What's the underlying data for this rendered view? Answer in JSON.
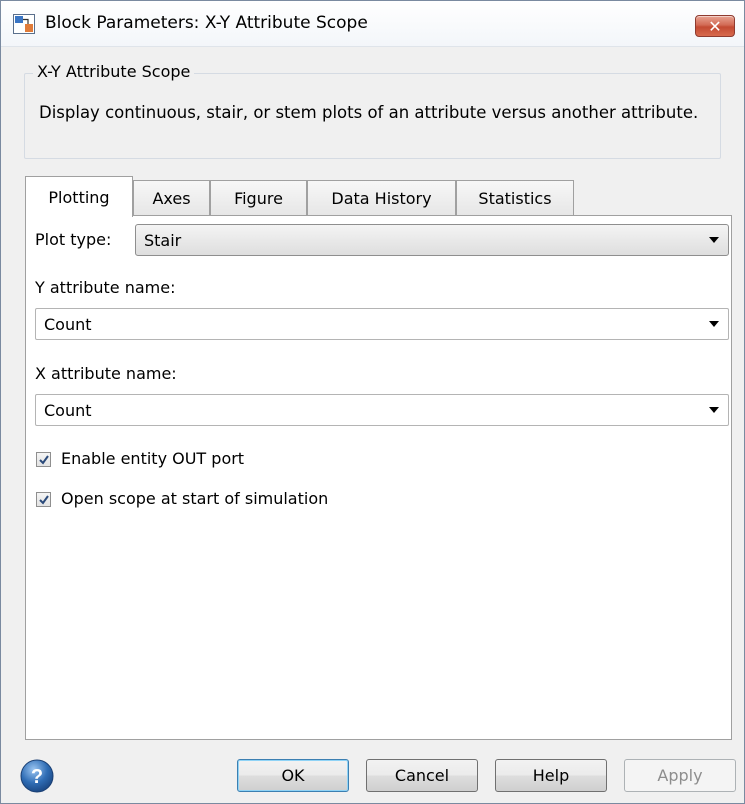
{
  "window": {
    "title": "Block Parameters: X-Y Attribute Scope",
    "close_glyph": "✕"
  },
  "group": {
    "title": "X-Y Attribute Scope",
    "description": "Display continuous, stair, or stem plots of an attribute versus another attribute."
  },
  "tabs": [
    {
      "label": "Plotting",
      "active": true
    },
    {
      "label": "Axes",
      "active": false
    },
    {
      "label": "Figure",
      "active": false
    },
    {
      "label": "Data History",
      "active": false
    },
    {
      "label": "Statistics",
      "active": false
    }
  ],
  "plotting": {
    "plot_type_label": "Plot type:",
    "plot_type_value": "Stair",
    "y_attr_label": "Y attribute name:",
    "y_attr_value": "Count",
    "x_attr_label": "X attribute name:",
    "x_attr_value": "Count",
    "enable_out_port_label": "Enable entity OUT port",
    "enable_out_port_checked": true,
    "open_scope_label": "Open scope at start of simulation",
    "open_scope_checked": true
  },
  "buttons": {
    "ok": "OK",
    "cancel": "Cancel",
    "help": "Help",
    "apply": "Apply"
  },
  "icons": {
    "app": "simulink-block-icon",
    "help": "help-question-icon",
    "checkmark": "checkmark-icon",
    "dropdown": "chevron-down-icon"
  },
  "colors": {
    "close_button": "#c9503a",
    "default_button_border": "#3c7fb1",
    "help_icon": "#2f6db5"
  }
}
